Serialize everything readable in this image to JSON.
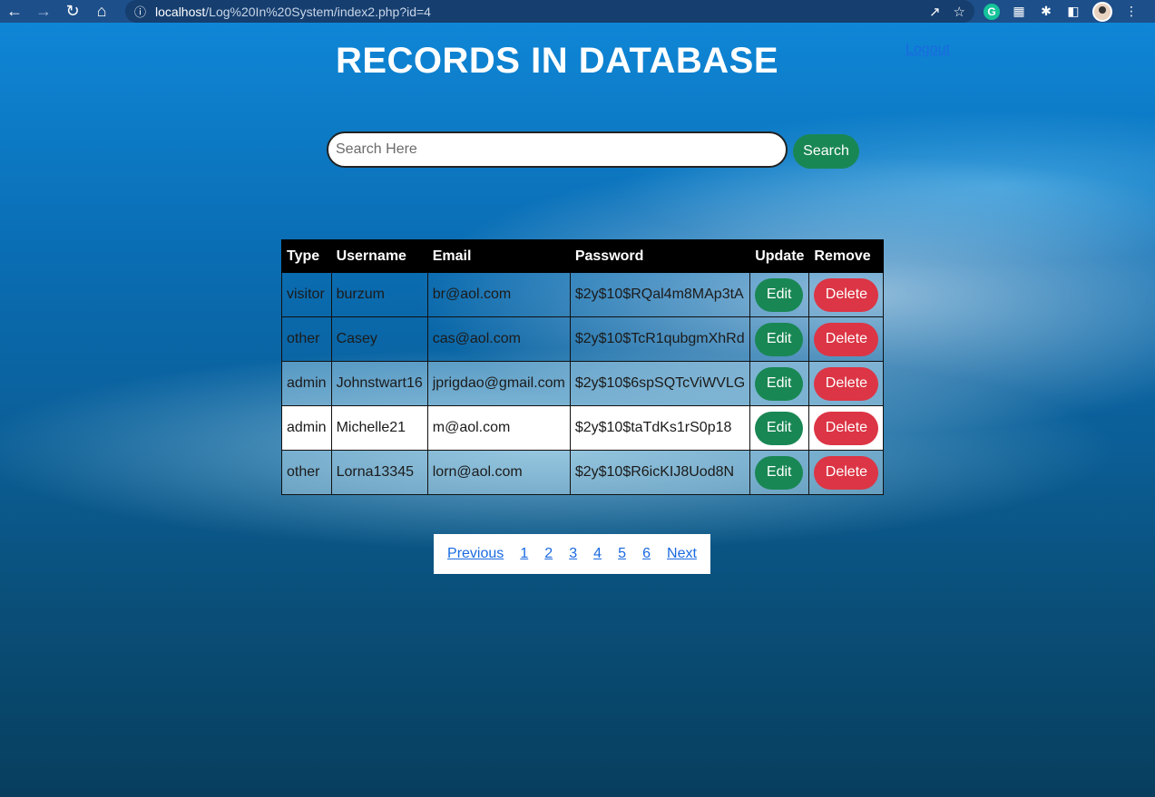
{
  "browser": {
    "url_host": "localhost",
    "url_path": "/Log%20In%20System/index2.php?id=4"
  },
  "page": {
    "title": "RECORDS IN DATABASE",
    "logout_label": "Logout",
    "search": {
      "placeholder": "Search Here",
      "button_label": "Search"
    }
  },
  "table": {
    "headers": [
      "Type",
      "Username",
      "Email",
      "Password",
      "Update",
      "Remove"
    ],
    "edit_label": "Edit",
    "delete_label": "Delete",
    "rows": [
      {
        "type": "visitor",
        "username": "burzum",
        "email": "br@aol.com",
        "password": "$2y$10$RQal4m8MAp3tA"
      },
      {
        "type": "other",
        "username": "Casey",
        "email": "cas@aol.com",
        "password": "$2y$10$TcR1qubgmXhRd"
      },
      {
        "type": "admin",
        "username": "Johnstwart16",
        "email": "jprigdao@gmail.com",
        "password": "$2y$10$6spSQTcViWVLG"
      },
      {
        "type": "admin",
        "username": "Michelle21",
        "email": "m@aol.com",
        "password": "$2y$10$taTdKs1rS0p18"
      },
      {
        "type": "other",
        "username": "Lorna13345",
        "email": "lorn@aol.com",
        "password": "$2y$10$R6icKIJ8Uod8N"
      }
    ]
  },
  "pagination": {
    "previous": "Previous",
    "pages": [
      "1",
      "2",
      "3",
      "4",
      "5",
      "6"
    ],
    "next": "Next"
  },
  "colors": {
    "edit_button": "#198754",
    "delete_button": "#dc3545",
    "link": "#1a6ae0"
  }
}
